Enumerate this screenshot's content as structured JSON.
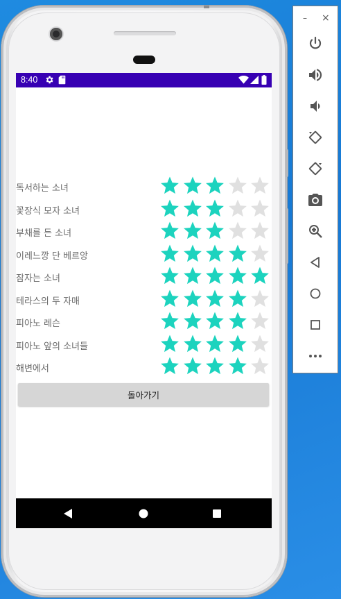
{
  "window_controls": {
    "minimize": "–",
    "close": "×"
  },
  "status_bar": {
    "time": "8:40",
    "icons": [
      "gear-icon",
      "sd-card-icon",
      "wifi-icon",
      "signal-icon",
      "battery-icon"
    ]
  },
  "ratings": [
    {
      "title": "독서하는 소녀",
      "stars": 3
    },
    {
      "title": "꽃장식 모자 소녀",
      "stars": 3
    },
    {
      "title": "부채를 든 소녀",
      "stars": 3
    },
    {
      "title": "이레느깡 단 베르앙",
      "stars": 4
    },
    {
      "title": "잠자는 소녀",
      "stars": 5
    },
    {
      "title": "테라스의 두 자매",
      "stars": 4
    },
    {
      "title": "피아노 레슨",
      "stars": 4
    },
    {
      "title": "피아노 앞의 소녀들",
      "stars": 4
    },
    {
      "title": "해변에서",
      "stars": 4
    }
  ],
  "max_stars": 5,
  "back_button": {
    "label": "돌아가기"
  },
  "nav_bar": [
    "back-icon",
    "home-icon",
    "overview-icon"
  ],
  "emulator_tools": [
    "power-icon",
    "volume-up-icon",
    "volume-down-icon",
    "rotate-left-icon",
    "rotate-right-icon",
    "camera-icon",
    "zoom-icon",
    "back-icon",
    "home-icon",
    "overview-icon",
    "more-icon"
  ],
  "colors": {
    "status_bar": "#3700b3",
    "star_filled": "#1cd3be",
    "star_empty": "#e0e0e0",
    "button_bg": "#d6d6d6",
    "nav_bar": "#000000"
  }
}
